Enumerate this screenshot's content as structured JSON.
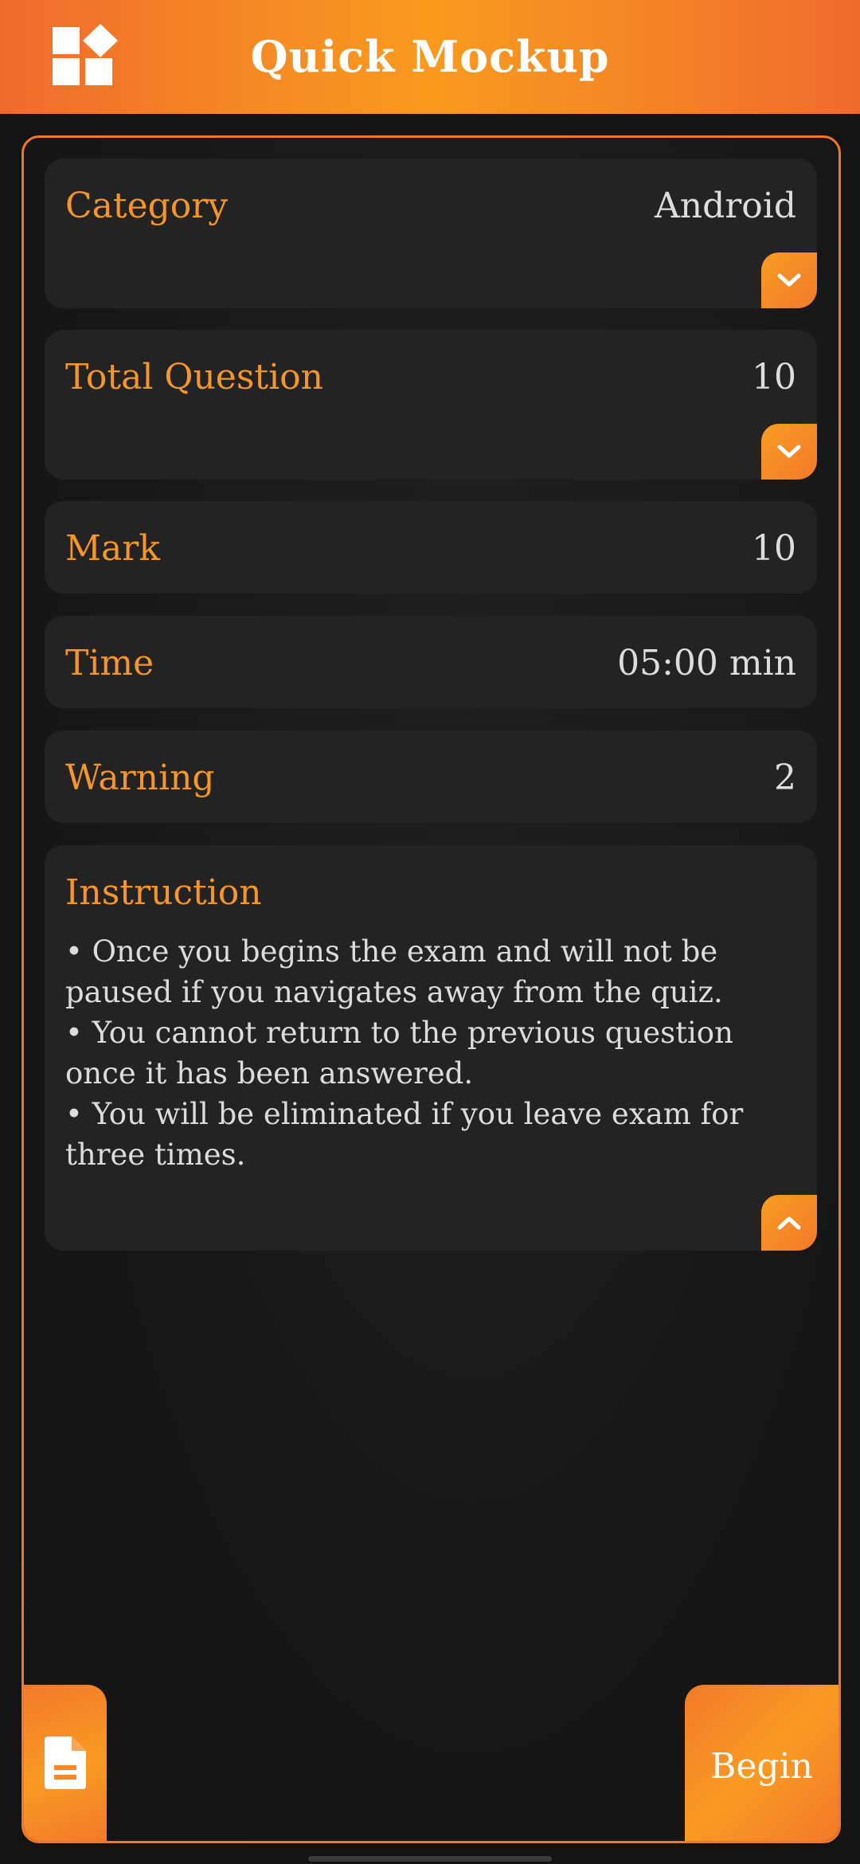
{
  "app_bar": {
    "title": "Quick Mockup",
    "menu_icon": "apps-grid-icon"
  },
  "fields": {
    "category": {
      "label": "Category",
      "value": "Android"
    },
    "total_question": {
      "label": "Total Question",
      "value": "10"
    },
    "mark": {
      "label": "Mark",
      "value": "10"
    },
    "time": {
      "label": "Time",
      "value": "05:00 min"
    },
    "warning": {
      "label": "Warning",
      "value": "2"
    }
  },
  "instruction": {
    "title": "Instruction",
    "lines": [
      "• Once you begins the exam and will not be paused if you navigates away from the quiz.",
      "• You cannot return to the previous question once it has been answered.",
      "• You will be eliminated if you leave exam for three times."
    ]
  },
  "actions": {
    "begin_label": "Begin",
    "doc_icon": "document-icon"
  },
  "colors": {
    "accent": "#f5952a",
    "background": "#131313",
    "card": "#232323"
  }
}
